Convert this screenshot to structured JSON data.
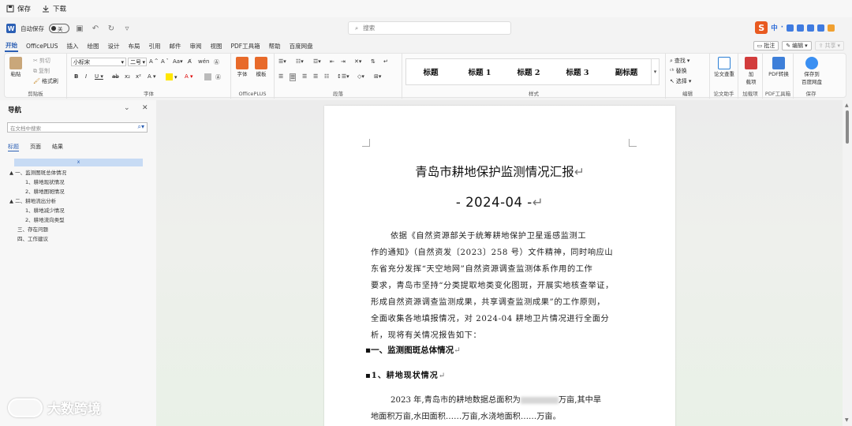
{
  "topbar": {
    "save": "保存",
    "download": "下载"
  },
  "titlebar": {
    "autosave_label": "自动保存",
    "autosave_state": "关",
    "search_placeholder": "搜索"
  },
  "ime": {
    "lang": "中",
    "extra": "·"
  },
  "tabs": [
    "开始",
    "OfficePLUS",
    "插入",
    "绘图",
    "设计",
    "布局",
    "引用",
    "邮件",
    "审阅",
    "视图",
    "PDF工具箱",
    "帮助",
    "百度网盘"
  ],
  "tabs_right": {
    "comments": "批注",
    "editing": "编辑",
    "share": "共享"
  },
  "ribbon": {
    "clipboard": {
      "paste": "粘贴",
      "cut": "剪切",
      "copy": "复制",
      "format_painter": "格式刷",
      "label": "剪贴板"
    },
    "font": {
      "font_name": "小标宋",
      "font_size": "二号",
      "label": "字体"
    },
    "officeplus": {
      "font_btn": "字体",
      "template_btn": "模板",
      "label": "OfficePLUS"
    },
    "paragraph": {
      "label": "段落"
    },
    "styles": {
      "items": [
        "标题",
        "标题 1",
        "标题 2",
        "标题 3",
        "副标题"
      ],
      "label": "样式"
    },
    "editing": {
      "find": "查找",
      "replace": "替换",
      "select": "选择",
      "label": "编辑"
    },
    "paper": {
      "btn": "论文查重",
      "label": "论文助手"
    },
    "addins": {
      "btn_line1": "加",
      "btn_line2": "载项",
      "label": "加载项"
    },
    "pdf": {
      "btn": "PDF转换",
      "label": "PDF工具箱"
    },
    "save": {
      "btn_line1": "保存到",
      "btn_line2": "百度网盘",
      "label": "保存"
    }
  },
  "nav": {
    "title": "导航",
    "search_placeholder": "在文档中搜索",
    "tabs": [
      "标题",
      "页面",
      "结果"
    ],
    "selected_marker": "x",
    "items": [
      "▲ 一、监测图斑总体情况",
      "1、耕地现状情况",
      "2、耕地图斑情况",
      "▲ 二、耕地流出分析",
      "1、耕地减少情况",
      "2、耕地流向类型",
      "三、存在问题",
      "四、工作建议"
    ]
  },
  "document": {
    "title": "青岛市耕地保护监测情况汇报",
    "date_line": "- 2024-04 -",
    "paragraph_lines": [
      "依据《自然资源部关于统筹耕地保护卫星遥感监测工",
      "作的通知》（自然资发〔2023〕258 号）文件精神，同时响应山",
      "东省充分发挥“天空地网”自然资源调查监测体系作用的工作",
      "要求，青岛市坚持“分类提取地类变化图斑，开展实地核查举证，",
      "形成自然资源调查监测成果，共享调查监测成果”的工作原则，",
      "全面收集各地填报情况，对 2024-04 耕地卫片情况进行全面分",
      "析，现将有关情况报告如下："
    ],
    "heading1": "一、监测图斑总体情况",
    "heading2": "1、耕地现状情况",
    "para2_a": "2023 年,青岛市的耕地数据总面积为",
    "para2_b": "万亩,其中旱",
    "para2_line2": "地面积万亩,水田面积……万亩,水浇地面积……万亩。"
  },
  "watermark": {
    "text": "大数跨境"
  },
  "colors": {
    "accent": "#2b5fb4",
    "ime": "#e85a20"
  }
}
